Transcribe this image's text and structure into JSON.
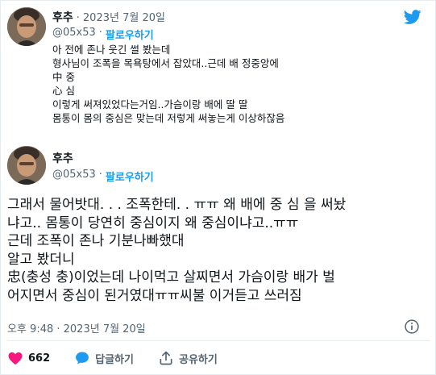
{
  "tweet1": {
    "author_name": "후추",
    "separator": "·",
    "date": "2023년 7월 20일",
    "handle": "@05x53",
    "follow_label": "팔로우하기",
    "lines": [
      "아 전에 존나 웃긴 썰 봤는데",
      "형사님이 조폭을 목욕탕에서 잡았대..근데 배 정중앙에",
      "中 중",
      "心 심",
      "이렇게 써져있었다는거임..가슴이랑 배에 딸 딸",
      "몸통이 몸의 중심은 맞는데 저렇게 써놓는게 이상하잖음"
    ]
  },
  "tweet2": {
    "author_name": "후추",
    "handle": "@05x53",
    "follow_label": "팔로우하기",
    "lines": [
      "그래서 물어밧대. . . 조폭한테. . ㅠㅠ 왜 배에 중 심 을 써놨",
      "냐고.. 몸통이 당연히 중심이지 왜 중심이냐고..ㅠㅠ",
      "근데 조폭이 존나 기분나빠했대",
      "알고 봤더니",
      "忠(충성 충)이었는데 나이먹고 살찌면서 가슴이랑 배가 벌",
      "어지면서 중심이 된거였대ㅠㅠ씨불 이거듣고 쓰러짐"
    ],
    "timestamp": "오후 9:48 · 2023년 7월 20일"
  },
  "actions": {
    "like_count": "662",
    "reply_label": "답글하기",
    "share_label": "공유하기"
  },
  "colors": {
    "twitter_blue": "#1d9bf0",
    "like_pink": "#f91880",
    "muted_text": "#536471"
  }
}
